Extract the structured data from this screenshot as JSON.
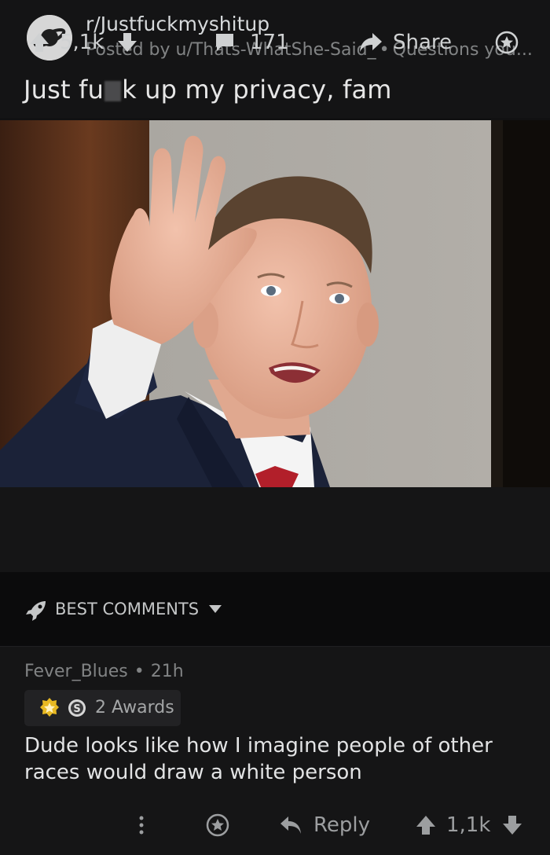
{
  "post": {
    "subreddit": "r/Justfuckmyshitup",
    "posted_by": "Posted by u/Thats-WhatShe-Said_",
    "flair": "Questions you...",
    "title_start": "Just fu",
    "title_end": "k up my privacy, fam"
  },
  "actions": {
    "upvotes": "5,1k",
    "comments": "171",
    "share": "Share"
  },
  "sort": {
    "label": "BEST COMMENTS"
  },
  "comment": {
    "author": "Fever_Blues",
    "age": "21h",
    "awards": "2 Awards",
    "body": "Dude looks like how I imagine people of other races would draw a white person",
    "reply": "Reply",
    "score": "1,1k"
  },
  "icons": [
    "planet-icon",
    "upvote-icon",
    "downvote-icon",
    "comment-icon",
    "share-icon",
    "award-icon",
    "rocket-icon",
    "chevron-down-icon",
    "more-icon",
    "reply-icon"
  ],
  "colors": {
    "background": "#111112",
    "text": "#d7dadc",
    "muted": "#818384"
  }
}
